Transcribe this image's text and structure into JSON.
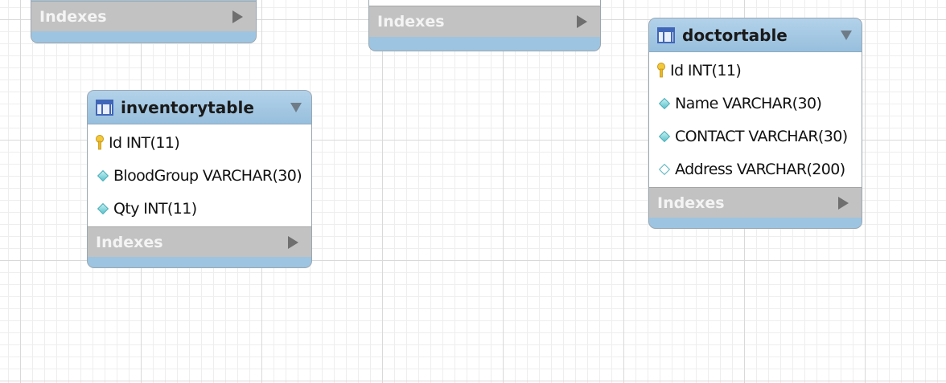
{
  "diagram": {
    "partial_entities": [
      {
        "name": "",
        "indexes_label": "Indexes"
      },
      {
        "name": "",
        "indexes_label": "Indexes"
      }
    ],
    "entities": [
      {
        "name": "inventorytable",
        "columns": [
          {
            "text": "Id INT(11)",
            "kind": "primary-key"
          },
          {
            "text": "BloodGroup VARCHAR(30)",
            "kind": "not-null"
          },
          {
            "text": "Qty INT(11)",
            "kind": "not-null"
          }
        ],
        "indexes_label": "Indexes"
      },
      {
        "name": "doctortable",
        "columns": [
          {
            "text": "Id INT(11)",
            "kind": "primary-key"
          },
          {
            "text": "Name VARCHAR(30)",
            "kind": "not-null"
          },
          {
            "text": "CONTACT VARCHAR(30)",
            "kind": "not-null"
          },
          {
            "text": "Address VARCHAR(200)",
            "kind": "nullable"
          }
        ],
        "indexes_label": "Indexes"
      }
    ]
  },
  "icons": {
    "table": "table-icon",
    "collapse": "triangle-down-icon",
    "expand": "triangle-right-icon",
    "primary_key": "key-icon",
    "not_null_column": "diamond-filled-icon",
    "nullable_column": "diamond-hollow-icon"
  },
  "colors": {
    "header": "#9dc4e0",
    "indexes_bar": "#c2c2c2",
    "table_icon": "#4066b8",
    "key": "#e8b821",
    "diamond": "#5ec3cc"
  }
}
